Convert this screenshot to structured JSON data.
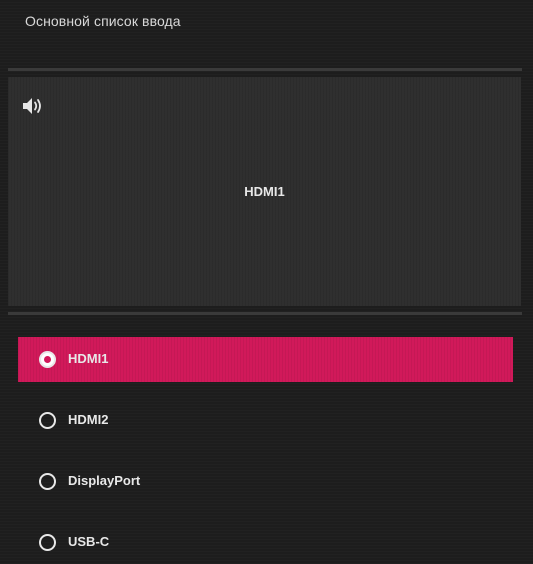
{
  "header": {
    "title": "Основной список ввода"
  },
  "preview": {
    "label": "HDMI1",
    "audio_icon": "speaker-volume-icon"
  },
  "inputs": [
    {
      "label": "HDMI1",
      "selected": true
    },
    {
      "label": "HDMI2",
      "selected": false
    },
    {
      "label": "DisplayPort",
      "selected": false
    },
    {
      "label": "USB-C",
      "selected": false
    }
  ],
  "colors": {
    "accent": "#d1195a",
    "background": "#1d1d1d",
    "preview_background": "#2f2f2f"
  }
}
